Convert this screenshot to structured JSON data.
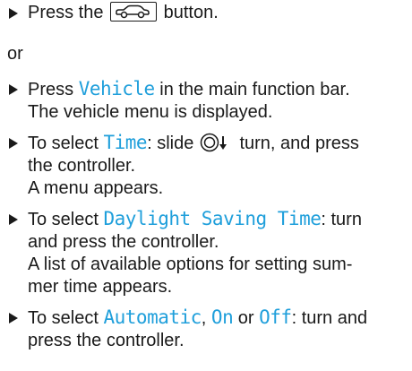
{
  "steps": [
    {
      "press": "Press the",
      "button": "button.",
      "car_icon": "car-icon"
    },
    {
      "press": "Press",
      "vehicle": "Vehicle",
      "rest": "in the main function bar.",
      "line2": "The vehicle menu is displayed."
    },
    {
      "to_select": "To select",
      "time": "Time",
      "slide": ": slide",
      "turn": "turn, and press",
      "line2": "the controller.",
      "line3": "A menu appears.",
      "controller_icon": "controller-knob-icon"
    },
    {
      "to_select": "To select",
      "dst": "Daylight Saving Time",
      "rest": ": turn",
      "line2": "and press the controller.",
      "line3": "A list of available options for setting sum-",
      "line4": "mer time appears."
    },
    {
      "to_select": "To select",
      "automatic": "Automatic",
      "comma": ",",
      "on": "On",
      "or_word": "or",
      "off": "Off",
      "rest": ": turn and",
      "line2": "press the controller."
    }
  ],
  "or_separator": "or",
  "colors": {
    "text": "#1a1a1a",
    "highlight": "#1f9fdb"
  }
}
